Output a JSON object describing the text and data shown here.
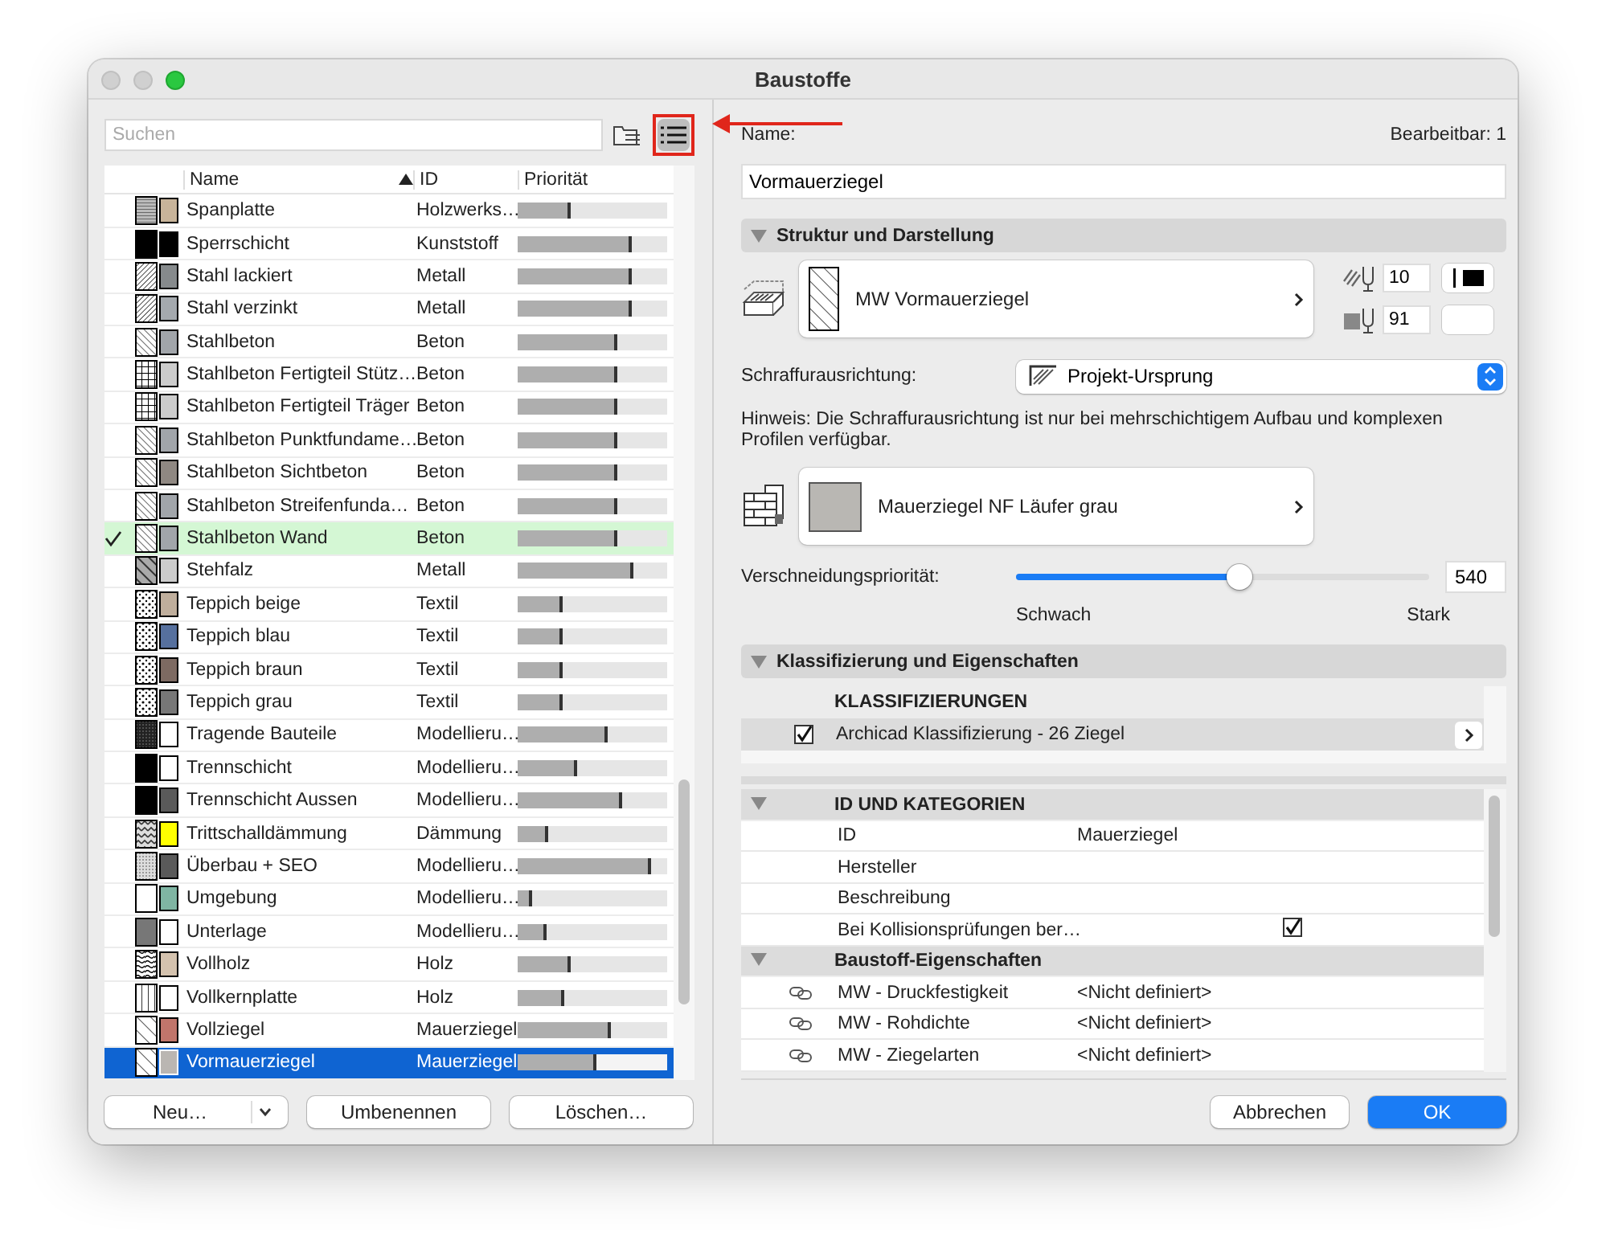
{
  "window": {
    "title": "Baustoffe"
  },
  "search": {
    "placeholder": "Suchen"
  },
  "view_buttons": [
    {
      "kind": "folders",
      "selected": false
    },
    {
      "kind": "list",
      "selected": true
    }
  ],
  "list": {
    "columns": [
      "Name",
      "ID",
      "Priorität"
    ],
    "rows": [
      {
        "kind": "horizontal",
        "color": "#c8b49a",
        "name": "Spanplatte",
        "id": "Holzwerks…",
        "level": 0.35,
        "checked": false,
        "selected": false
      },
      {
        "kind": "solid",
        "color": "#000000",
        "name": "Sperrschicht",
        "id": "Kunststoff",
        "level": 0.76,
        "checked": false,
        "selected": false
      },
      {
        "kind": "diagonal-dense",
        "color": "#868a8c",
        "name": "Stahl lackiert",
        "id": "Metall",
        "level": 0.76,
        "checked": false,
        "selected": false
      },
      {
        "kind": "diagonal-dense",
        "color": "#a4a9ae",
        "name": "Stahl verzinkt",
        "id": "Metall",
        "level": 0.76,
        "checked": false,
        "selected": false
      },
      {
        "kind": "diagonal",
        "color": "#a1a5aa",
        "name": "Stahlbeton",
        "id": "Beton",
        "level": 0.67,
        "checked": false,
        "selected": false
      },
      {
        "kind": "grid",
        "color": "#cccccc",
        "name": "Stahlbeton Fertigteil Stütz…",
        "id": "Beton",
        "level": 0.67,
        "checked": false,
        "selected": false
      },
      {
        "kind": "grid",
        "color": "#cccccc",
        "name": "Stahlbeton Fertigteil Träger",
        "id": "Beton",
        "level": 0.67,
        "checked": false,
        "selected": false
      },
      {
        "kind": "diagonal",
        "color": "#a1a5aa",
        "name": "Stahlbeton Punktfundame…",
        "id": "Beton",
        "level": 0.67,
        "checked": false,
        "selected": false
      },
      {
        "kind": "diagonal",
        "color": "#8f8882",
        "name": "Stahlbeton Sichtbeton",
        "id": "Beton",
        "level": 0.67,
        "checked": false,
        "selected": false
      },
      {
        "kind": "diagonal",
        "color": "#a1a5aa",
        "name": "Stahlbeton Streifenfunda…",
        "id": "Beton",
        "level": 0.67,
        "checked": false,
        "selected": false
      },
      {
        "kind": "diagonal",
        "color": "#a1a5aa",
        "name": "Stahlbeton Wand",
        "id": "Beton",
        "level": 0.67,
        "checked": true,
        "selected": false
      },
      {
        "kind": "diagonal-bold",
        "color": "#cccccc",
        "name": "Stehfalz",
        "id": "Metall",
        "level": 0.77,
        "checked": false,
        "selected": false
      },
      {
        "kind": "dots",
        "color": "#bfae9c",
        "name": "Teppich beige",
        "id": "Textil",
        "level": 0.3,
        "checked": false,
        "selected": false
      },
      {
        "kind": "dots",
        "color": "#56709e",
        "name": "Teppich blau",
        "id": "Textil",
        "level": 0.3,
        "checked": false,
        "selected": false
      },
      {
        "kind": "dots",
        "color": "#7d6a62",
        "name": "Teppich braun",
        "id": "Textil",
        "level": 0.3,
        "checked": false,
        "selected": false
      },
      {
        "kind": "dots",
        "color": "#777777",
        "name": "Teppich grau",
        "id": "Textil",
        "level": 0.3,
        "checked": false,
        "selected": false
      },
      {
        "kind": "dense",
        "color": "#ffffff",
        "name": "Tragende Bauteile",
        "id": "Modellieru…",
        "level": 0.6,
        "checked": false,
        "selected": false
      },
      {
        "kind": "solid",
        "color": "#ffffff",
        "name": "Trennschicht",
        "id": "Modellieru…",
        "level": 0.4,
        "checked": false,
        "selected": false
      },
      {
        "kind": "solid",
        "color": "#5a5a5a",
        "name": "Trennschicht Aussen",
        "id": "Modellieru…",
        "level": 0.7,
        "checked": false,
        "selected": false
      },
      {
        "kind": "wave",
        "color": "#ffff00",
        "name": "Trittschalldämmung",
        "id": "Dämmung",
        "level": 0.2,
        "checked": false,
        "selected": false
      },
      {
        "kind": "fine",
        "color": "#5a5a5a",
        "name": "Überbau + SEO",
        "id": "Modellieru…",
        "level": 0.89,
        "checked": false,
        "selected": false
      },
      {
        "kind": "empty",
        "color": "#7fb5a3",
        "name": "Umgebung",
        "id": "Modellieru…",
        "level": 0.1,
        "checked": false,
        "selected": false
      },
      {
        "kind": "grey",
        "color": "#ffffff",
        "name": "Unterlage",
        "id": "Modellieru…",
        "level": 0.19,
        "checked": false,
        "selected": false
      },
      {
        "kind": "wood",
        "color": "#d4c2ae",
        "name": "Vollholz",
        "id": "Holz",
        "level": 0.35,
        "checked": false,
        "selected": false
      },
      {
        "kind": "vertical",
        "color": "#ffffff",
        "name": "Vollkernplatte",
        "id": "Holz",
        "level": 0.31,
        "checked": false,
        "selected": false
      },
      {
        "kind": "sparse",
        "color": "#c0756b",
        "name": "Vollziegel",
        "id": "Mauerziegel",
        "level": 0.62,
        "checked": false,
        "selected": false
      },
      {
        "kind": "sparse",
        "color": "#bab6b2",
        "name": "Vormauerziegel",
        "id": "Mauerziegel",
        "level": 0.53,
        "checked": false,
        "selected": true
      }
    ]
  },
  "left_buttons": [
    {
      "kind": "split",
      "label": "Neu…"
    },
    {
      "kind": "plain",
      "label": "Umbenennen"
    },
    {
      "kind": "plain",
      "label": "Löschen…"
    }
  ],
  "name_label": "Name:",
  "editable": "Bearbeitbar: 1",
  "name_value": "Vormauerziegel",
  "structure": {
    "title": "Struktur und Darstellung",
    "expanded": true,
    "building_material": "MW Vormauerziegel",
    "pens": [
      {
        "kind": "hatch",
        "value": "10"
      },
      {
        "kind": "fill",
        "value": "91"
      }
    ],
    "orientation_label": "Schraffurausrichtung:",
    "orientation_value": "Projekt-Ursprung",
    "hint": "Hinweis: Die Schraffurausrichtung ist nur bei mehrschichtigem Aufbau und komplexen Profilen verfügbar.",
    "surface": {
      "label": "Mauerziegel NF Läufer grau",
      "color": "#b9b7b3"
    },
    "priority_label": "Verschneidungspriorität:",
    "priority": {
      "level": 0.54,
      "value": "540",
      "min_label": "Schwach",
      "max_label": "Stark"
    }
  },
  "classification": {
    "title": "Klassifizierung und Eigenschaften",
    "expanded": true,
    "header": "KLASSIFIZIERUNGEN",
    "items": [
      {
        "label": "Archicad Klassifizierung - 26 Ziegel",
        "checked": true
      }
    ]
  },
  "properties": [
    {
      "title": "ID UND KATEGORIEN",
      "expanded": true,
      "rows": [
        {
          "kind": "text",
          "label": "ID",
          "value": "Mauerziegel"
        },
        {
          "kind": "text",
          "label": "Hersteller"
        },
        {
          "kind": "text",
          "label": "Beschreibung"
        },
        {
          "kind": "check",
          "label": "Bei Kollisionsprüfungen ber…",
          "checked": true
        }
      ]
    },
    {
      "title": "Baustoff-Eigenschaften",
      "expanded": true,
      "rows": [
        {
          "kind": "linked",
          "label": "MW - Druckfestigkeit",
          "value": "<Nicht definiert>"
        },
        {
          "kind": "linked",
          "label": "MW - Rohdichte",
          "value": "<Nicht definiert>"
        },
        {
          "kind": "linked",
          "label": "MW - Ziegelarten",
          "value": "<Nicht definiert>"
        }
      ]
    }
  ],
  "dialog_buttons": [
    {
      "kind": "secondary",
      "label": "Abbrechen"
    },
    {
      "kind": "primary",
      "label": "OK"
    }
  ]
}
